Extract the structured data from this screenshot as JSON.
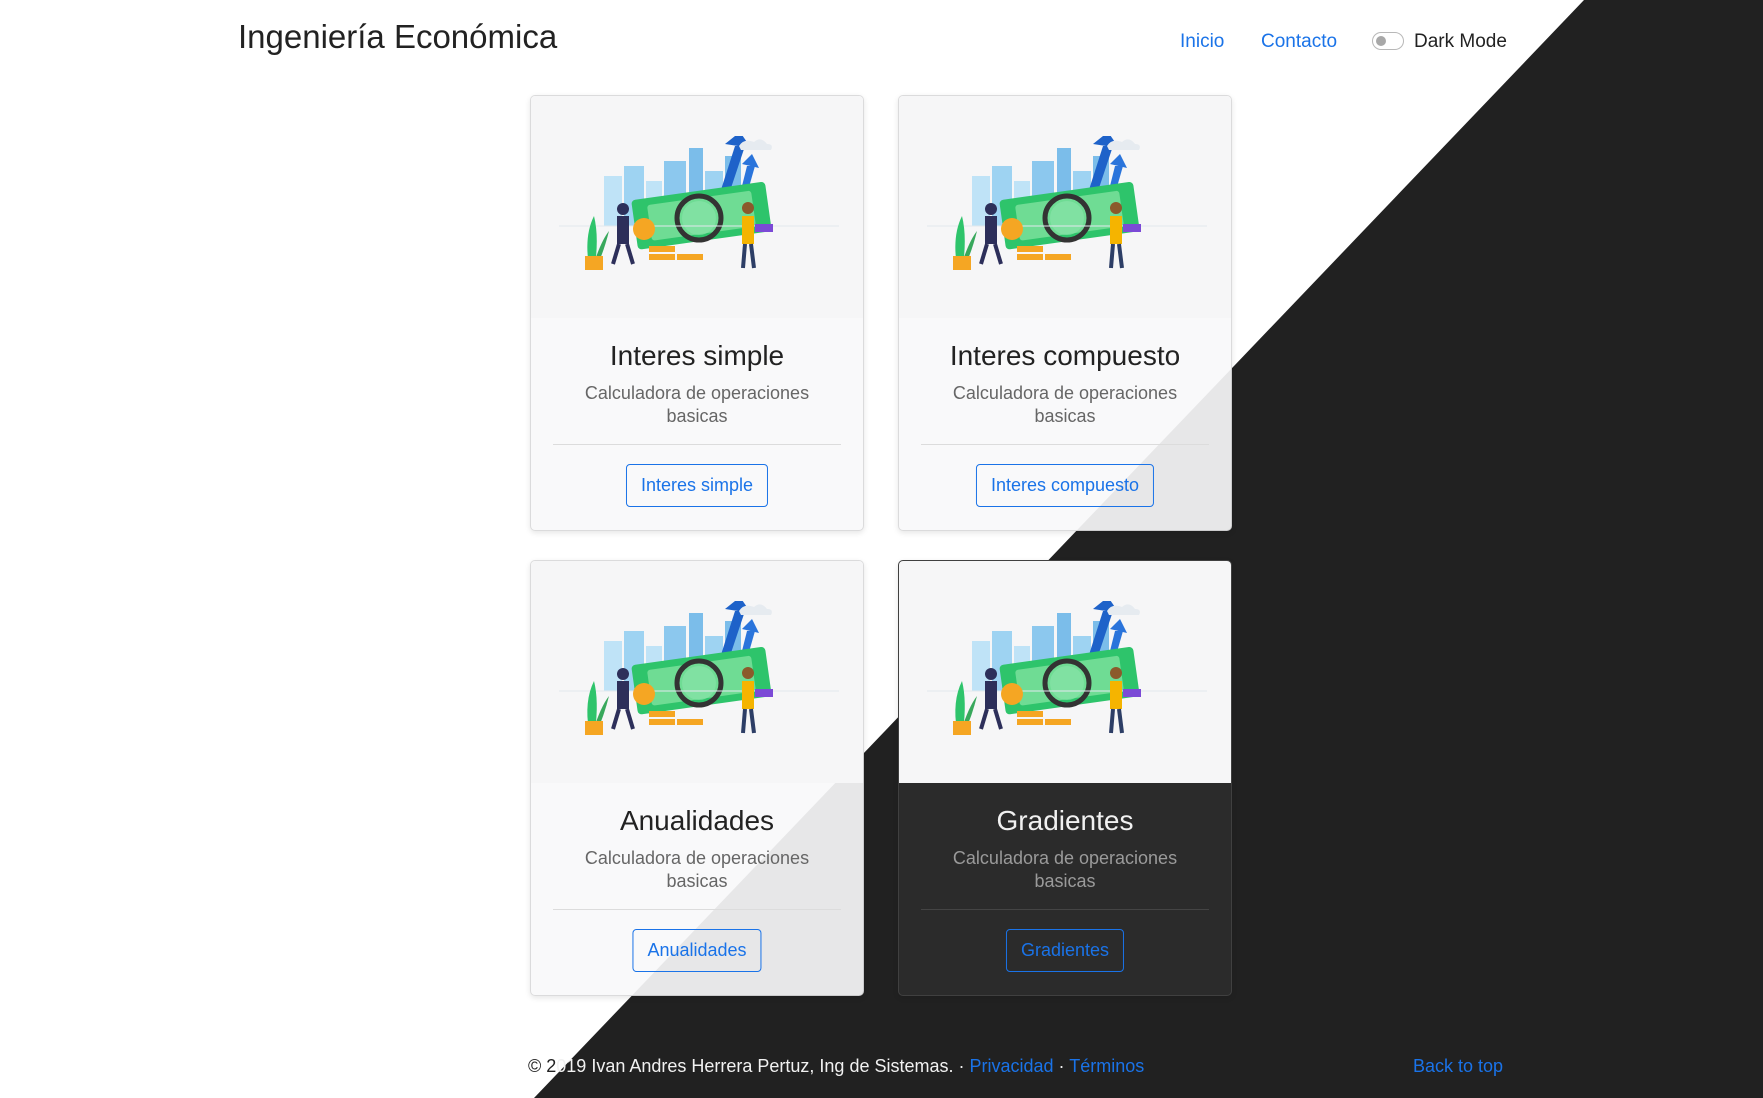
{
  "header": {
    "brand": "Ingeniería Económica",
    "nav": [
      {
        "label": "Inicio"
      },
      {
        "label": "Contacto"
      }
    ],
    "dark_mode_label": "Dark Mode",
    "dark_mode_on": false
  },
  "cards": [
    {
      "title": "Interes simple",
      "subtitle": "Calculadora de operaciones basicas",
      "button": "Interes simple"
    },
    {
      "title": "Interes compuesto",
      "subtitle": "Calculadora de operaciones basicas",
      "button": "Interes compuesto"
    },
    {
      "title": "Anualidades",
      "subtitle": "Calculadora de operaciones basicas",
      "button": "Anualidades"
    },
    {
      "title": "Gradientes",
      "subtitle": "Calculadora de operaciones basicas",
      "button": "Gradientes"
    }
  ],
  "footer": {
    "copyright_prefix": "© 2",
    "copyright_rest": "019 Ivan Andres Herrera Pertuz, Ing de Sistemas. · ",
    "privacy": "Privacidad",
    "separator": " · ",
    "terms": "Términos",
    "back_to_top": "Back to top"
  },
  "theme": {
    "link_color": "#1a73e8",
    "dark_bg": "#212121"
  }
}
